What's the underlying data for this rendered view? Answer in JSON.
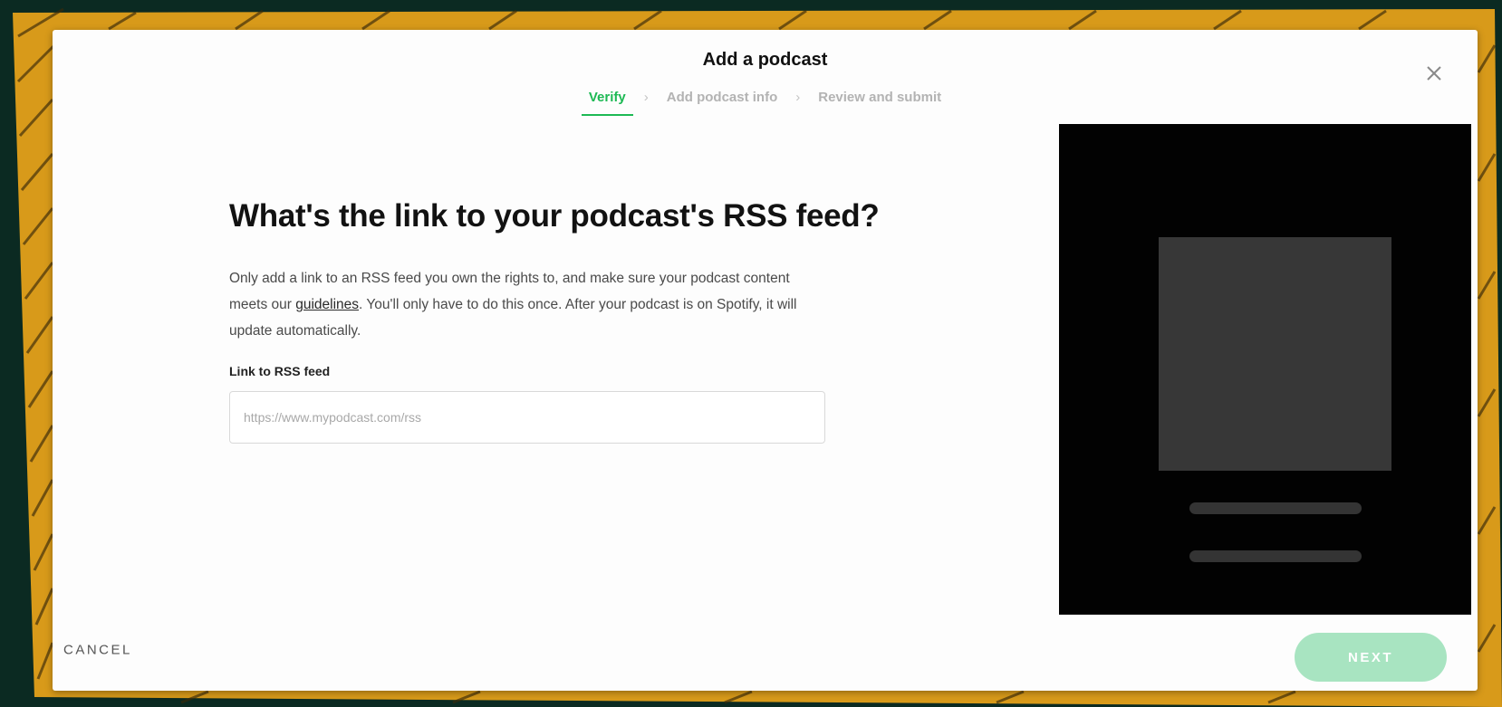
{
  "modal": {
    "title": "Add a podcast",
    "close_icon": "close-icon"
  },
  "stepper": {
    "steps": [
      {
        "label": "Verify",
        "active": true
      },
      {
        "label": "Add podcast info",
        "active": false
      },
      {
        "label": "Review and submit",
        "active": false
      }
    ],
    "separator": "›"
  },
  "content": {
    "heading": "What's the link to your podcast's RSS feed?",
    "description_before": "Only add a link to an RSS feed you own the rights to, and make sure your podcast content meets our ",
    "guidelines_link": "guidelines",
    "description_after": ". You'll only have to do this once. After your podcast is on Spotify, it will update automatically.",
    "field_label": "Link to RSS feed",
    "input_placeholder": "https://www.mypodcast.com/rss",
    "input_value": ""
  },
  "footer": {
    "cancel_label": "CANCEL",
    "next_label": "NEXT"
  },
  "colors": {
    "accent": "#1db954",
    "next_disabled": "#a8e4c1",
    "preview_bg": "#020202",
    "preview_art": "#373737"
  }
}
